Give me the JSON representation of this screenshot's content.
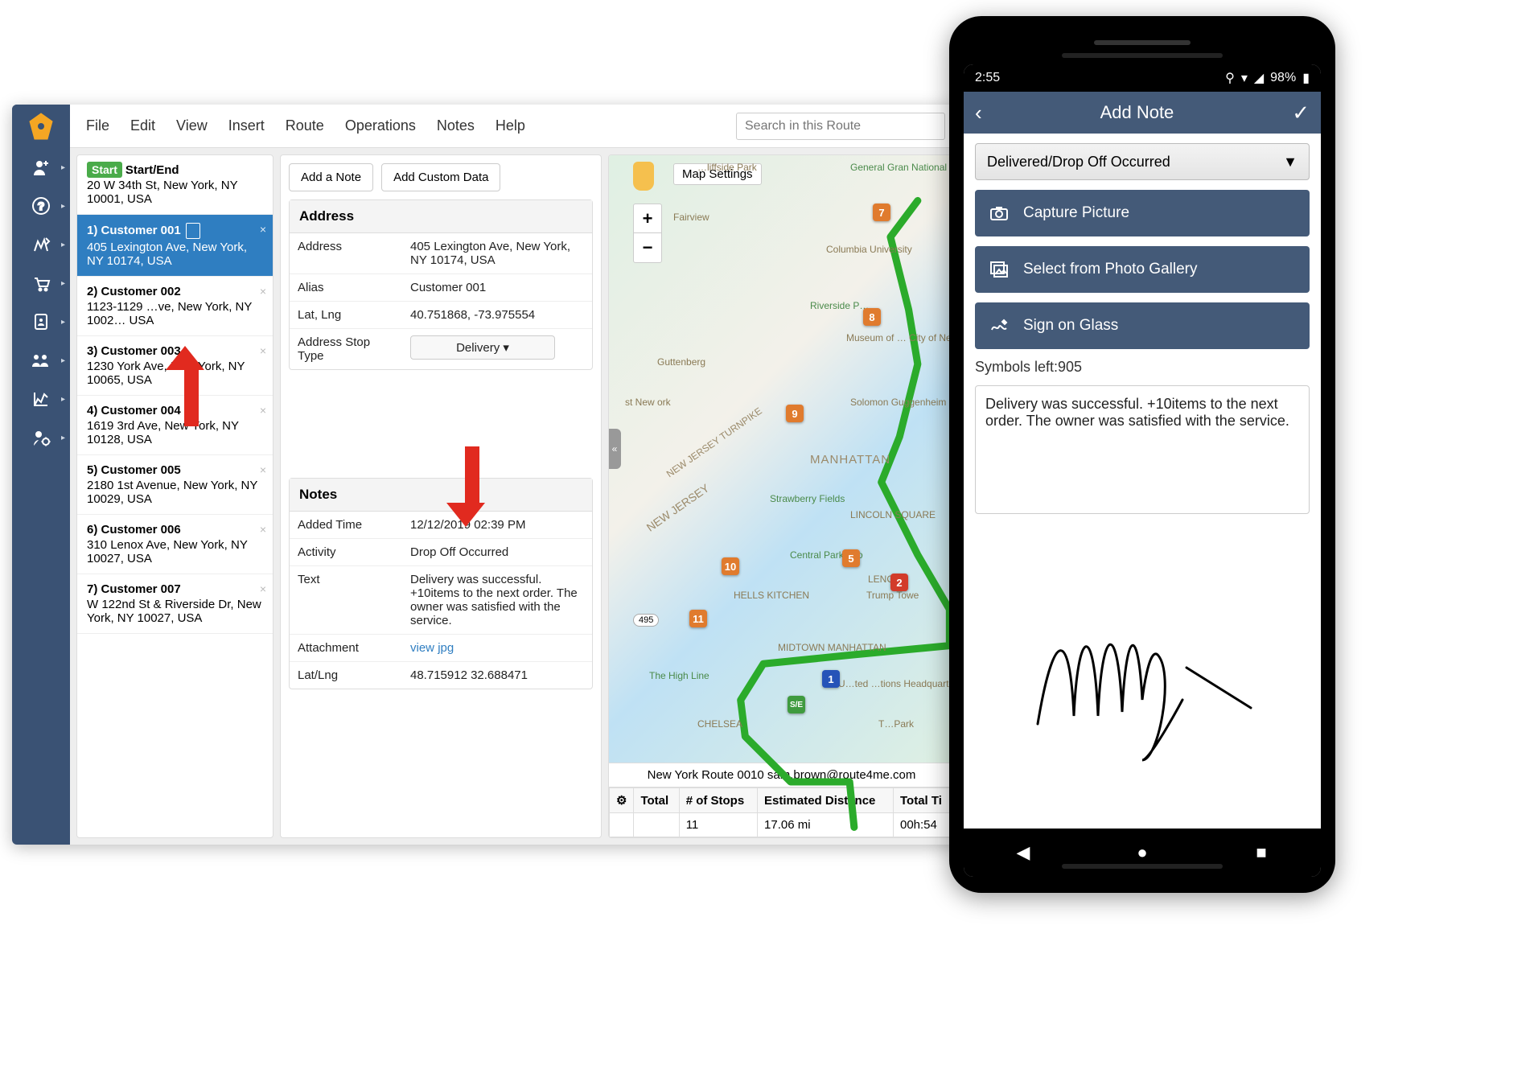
{
  "desktop": {
    "menu": {
      "file": "File",
      "edit": "Edit",
      "view": "View",
      "insert": "Insert",
      "route": "Route",
      "operations": "Operations",
      "notes": "Notes",
      "help": "Help"
    },
    "search_placeholder": "Search in this Route",
    "stops": {
      "start": {
        "badge": "Start",
        "title": "Start/End",
        "addr": "20 W 34th St, New York, NY 10001, USA"
      },
      "items": [
        {
          "title": "1) Customer 001",
          "addr": "405 Lexington Ave, New York, NY 10174, USA"
        },
        {
          "title": "2) Customer 002",
          "addr": "1123-1129 …ve, New York, NY 1002… USA"
        },
        {
          "title": "3) Customer 003",
          "addr": "1230 York Ave, New York, NY 10065, USA"
        },
        {
          "title": "4) Customer 004",
          "addr": "1619 3rd Ave, New York, NY 10128, USA"
        },
        {
          "title": "5) Customer 005",
          "addr": "2180 1st Avenue, New York, NY 10029, USA"
        },
        {
          "title": "6) Customer 006",
          "addr": "310 Lenox Ave, New York, NY 10027, USA"
        },
        {
          "title": "7) Customer 007",
          "addr": "W 122nd St & Riverside Dr, New York, NY 10027, USA"
        }
      ]
    },
    "detail": {
      "add_note": "Add a Note",
      "add_custom": "Add Custom Data",
      "address_header": "Address",
      "fields": {
        "address_lbl": "Address",
        "address_val": "405 Lexington Ave, New York, NY 10174, USA",
        "alias_lbl": "Alias",
        "alias_val": "Customer 001",
        "latlng_lbl": "Lat, Lng",
        "latlng_val": "40.751868, -73.975554",
        "stoptype_lbl": "Address Stop Type",
        "stoptype_val": "Delivery ▾"
      },
      "notes_header": "Notes",
      "notes": {
        "added_lbl": "Added Time",
        "added_val": "12/12/2019 02:39 PM",
        "activity_lbl": "Activity",
        "activity_val": "Drop Off Occurred",
        "text_lbl": "Text",
        "text_val": "Delivery was successful. +10items to the next order. The owner was satisfied with the service.",
        "attach_lbl": "Attachment",
        "attach_link": "view",
        "attach_ext": "jpg",
        "latlng_lbl": "Lat/Lng",
        "latlng_val": "48.715912 32.688471"
      }
    },
    "map": {
      "settings": "Map Settings",
      "route_title": "New York Route 0010 sam.brown@route4me.com",
      "stats": {
        "total_lbl": "Total",
        "stops_hdr": "# of Stops",
        "stops_val": "11",
        "dist_hdr": "Estimated Distance",
        "dist_val": "17.06 mi",
        "time_hdr": "Total Ti",
        "time_val": "00h:54"
      },
      "labels": {
        "park": "…liffside Park",
        "grandnational": "General Gran National Memorial",
        "fairview": "Fairview",
        "columbia": "Columbia University",
        "riverside": "Riverside P…",
        "museum": "Museum of …  City of New Y…",
        "guttenberg": "Guttenberg",
        "solomon": "Solomon Guggenheim  Museur",
        "manhattan": "MANHATTAN",
        "strawberry": "Strawberry Fields",
        "lincoln": "LINCOLN SQUARE",
        "zoo": "Central Park Zoo",
        "hells": "HELLS KITCHEN",
        "lenox": "LENOX",
        "trump": "Trump Towe",
        "midtown": "MIDTOWN MANHATTAN",
        "highline": "The High Line",
        "un": "U…ted  …tions Headquarters",
        "chelsea": "CHELSEA",
        "tpark": "T…Park",
        "westny": "st New ork",
        "njturn": "NEW JERSEY TURNPIKE",
        "njersey": "NEW JERSEY"
      }
    }
  },
  "phone": {
    "time": "2:55",
    "battery": "98%",
    "header_title": "Add Note",
    "dropdown": "Delivered/Drop Off Occurred",
    "btn_capture": "Capture Picture",
    "btn_gallery": "Select from Photo Gallery",
    "btn_sign": "Sign on Glass",
    "symbols_left": "Symbols left:905",
    "note_text": "Delivery was successful. +10items to the next order. The owner was satisfied with the service."
  }
}
